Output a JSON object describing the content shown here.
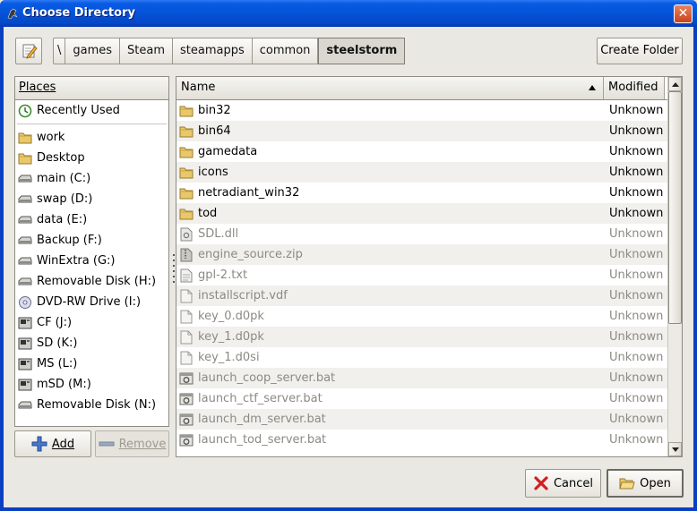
{
  "window": {
    "title": "Choose Directory",
    "close_icon": "close-icon"
  },
  "path": {
    "edit_icon": "edit-location-icon",
    "crumbs": [
      "\\",
      "games",
      "Steam",
      "steamapps",
      "common",
      "steelstorm"
    ],
    "active_crumb": "steelstorm"
  },
  "create_folder_label": "Create Folder",
  "places": {
    "header": "Places",
    "recent": {
      "label": "Recently Used",
      "icon": "recent-icon"
    },
    "bookmarks": [
      {
        "label": "work",
        "icon": "folder-icon"
      },
      {
        "label": "Desktop",
        "icon": "folder-icon"
      },
      {
        "label": "main (C:)",
        "icon": "drive-icon"
      },
      {
        "label": "swap (D:)",
        "icon": "drive-icon"
      },
      {
        "label": "data (E:)",
        "icon": "drive-icon"
      },
      {
        "label": "Backup (F:)",
        "icon": "drive-icon"
      },
      {
        "label": "WinExtra (G:)",
        "icon": "drive-icon"
      },
      {
        "label": "Removable Disk (H:)",
        "icon": "drive-icon"
      },
      {
        "label": "DVD-RW Drive (I:)",
        "icon": "optical-drive-icon"
      },
      {
        "label": "CF (J:)",
        "icon": "card-reader-icon"
      },
      {
        "label": "SD (K:)",
        "icon": "card-reader-icon"
      },
      {
        "label": "MS (L:)",
        "icon": "card-reader-icon"
      },
      {
        "label": "mSD (M:)",
        "icon": "card-reader-icon"
      },
      {
        "label": "Removable Disk (N:)",
        "icon": "drive-icon"
      }
    ],
    "add_label": "Add",
    "remove_label": "Remove"
  },
  "files": {
    "columns": {
      "name": "Name",
      "modified": "Modified"
    },
    "sort": "ascending",
    "rows": [
      {
        "name": "bin32",
        "modified": "Unknown",
        "type": "folder",
        "icon": "folder-icon"
      },
      {
        "name": "bin64",
        "modified": "Unknown",
        "type": "folder",
        "icon": "folder-icon"
      },
      {
        "name": "gamedata",
        "modified": "Unknown",
        "type": "folder",
        "icon": "folder-icon"
      },
      {
        "name": "icons",
        "modified": "Unknown",
        "type": "folder",
        "icon": "folder-icon"
      },
      {
        "name": "netradiant_win32",
        "modified": "Unknown",
        "type": "folder",
        "icon": "folder-icon"
      },
      {
        "name": "tod",
        "modified": "Unknown",
        "type": "folder",
        "icon": "folder-icon"
      },
      {
        "name": "SDL.dll",
        "modified": "Unknown",
        "type": "file",
        "icon": "library-file-icon"
      },
      {
        "name": "engine_source.zip",
        "modified": "Unknown",
        "type": "file",
        "icon": "archive-file-icon"
      },
      {
        "name": "gpl-2.txt",
        "modified": "Unknown",
        "type": "file",
        "icon": "text-file-icon"
      },
      {
        "name": "installscript.vdf",
        "modified": "Unknown",
        "type": "file",
        "icon": "document-file-icon"
      },
      {
        "name": "key_0.d0pk",
        "modified": "Unknown",
        "type": "file",
        "icon": "document-file-icon"
      },
      {
        "name": "key_1.d0pk",
        "modified": "Unknown",
        "type": "file",
        "icon": "document-file-icon"
      },
      {
        "name": "key_1.d0si",
        "modified": "Unknown",
        "type": "file",
        "icon": "document-file-icon"
      },
      {
        "name": "launch_coop_server.bat",
        "modified": "Unknown",
        "type": "file",
        "icon": "script-file-icon"
      },
      {
        "name": "launch_ctf_server.bat",
        "modified": "Unknown",
        "type": "file",
        "icon": "script-file-icon"
      },
      {
        "name": "launch_dm_server.bat",
        "modified": "Unknown",
        "type": "file",
        "icon": "script-file-icon"
      },
      {
        "name": "launch_tod_server.bat",
        "modified": "Unknown",
        "type": "file",
        "icon": "script-file-icon"
      }
    ]
  },
  "buttons": {
    "cancel_label": "Cancel",
    "open_label": "Open"
  },
  "colors": {
    "titlebar": "#0553d8",
    "dialog_bg": "#eae8e3",
    "folder": "#e8c86a",
    "row_alt": "#f1f0ed"
  }
}
